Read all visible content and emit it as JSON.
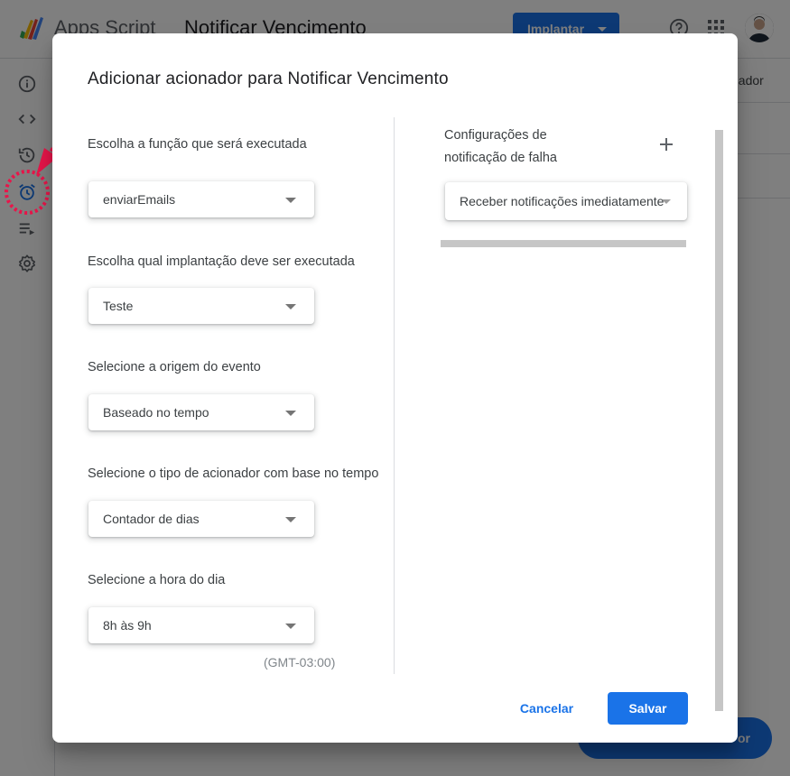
{
  "app": {
    "name": "Apps Script",
    "project_title": "Notificar Vencimento",
    "deploy_label": "Implantar",
    "bg_right_text": "nador",
    "fab_label": "or"
  },
  "dialog": {
    "title": "Adicionar acionador para Notificar Vencimento",
    "fields": [
      {
        "label": "Escolha a função que será executada",
        "value": "enviarEmails"
      },
      {
        "label": "Escolha qual implantação deve ser executada",
        "value": "Teste"
      },
      {
        "label": "Selecione a origem do evento",
        "value": "Baseado no tempo"
      },
      {
        "label": "Selecione o tipo de acionador com base no tempo",
        "value": "Contador de dias"
      },
      {
        "label": "Selecione a hora do dia",
        "value": "8h às 9h"
      }
    ],
    "timezone": "(GMT-03:00)",
    "failure_notifications": {
      "label": "Configurações de notificação de falha",
      "value": "Receber notificações imediatamente"
    },
    "cancel_label": "Cancelar",
    "save_label": "Salvar"
  },
  "colors": {
    "accent": "#1a73e8",
    "annotation": "#e8154a"
  },
  "icons": [
    "info-icon",
    "code-icon",
    "history-icon",
    "alarm-icon",
    "executions-icon",
    "settings-icon",
    "help-icon",
    "apps-icon",
    "add-icon"
  ]
}
